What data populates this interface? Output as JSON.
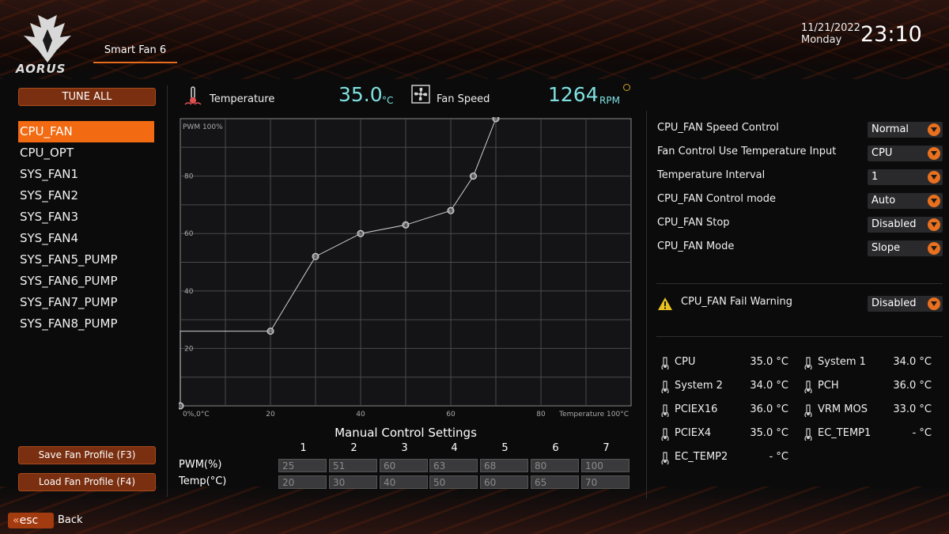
{
  "header": {
    "brand": "AORUS",
    "tab": "Smart Fan 6",
    "date": "11/21/2022",
    "day": "Monday",
    "time": "23:10"
  },
  "left_panel": {
    "tune_all": "TUNE ALL",
    "fans": [
      "CPU_FAN",
      "CPU_OPT",
      "SYS_FAN1",
      "SYS_FAN2",
      "SYS_FAN3",
      "SYS_FAN4",
      "SYS_FAN5_PUMP",
      "SYS_FAN6_PUMP",
      "SYS_FAN7_PUMP",
      "SYS_FAN8_PUMP"
    ],
    "selected_fan": "CPU_FAN",
    "save_profile": "Save Fan Profile (F3)",
    "load_profile": "Load Fan Profile (F4)"
  },
  "footer": {
    "esc": "esc",
    "back": "Back"
  },
  "readouts": {
    "temperature_label": "Temperature",
    "temperature_value": "35.0",
    "temperature_unit": "°C",
    "fan_speed_label": "Fan Speed",
    "fan_speed_value": "1264",
    "fan_speed_unit": "RPM"
  },
  "chart_data": {
    "type": "line",
    "ylabel": "PWM 100%",
    "xlabel": "Temperature 100°C",
    "origin_label": "0%,0°C",
    "xlim": [
      0,
      100
    ],
    "ylim": [
      0,
      100
    ],
    "x_ticks": [
      "20",
      "40",
      "60",
      "80"
    ],
    "y_ticks": [
      "20",
      "40",
      "60",
      "80"
    ],
    "series": [
      {
        "points": [
          {
            "label": "0",
            "x": 0,
            "y": 0
          },
          {
            "label": "",
            "x": 0,
            "y": 26
          },
          {
            "label": "1",
            "x": 20,
            "y": 26
          },
          {
            "label": "2",
            "x": 30,
            "y": 52
          },
          {
            "label": "3",
            "x": 40,
            "y": 60
          },
          {
            "label": "4",
            "x": 50,
            "y": 63
          },
          {
            "label": "5",
            "x": 60,
            "y": 68
          },
          {
            "label": "6",
            "x": 65,
            "y": 80
          },
          {
            "label": "7",
            "x": 70,
            "y": 100
          }
        ]
      }
    ]
  },
  "manual": {
    "title": "Manual Control Settings",
    "columns": [
      "1",
      "2",
      "3",
      "4",
      "5",
      "6",
      "7"
    ],
    "pwm_label": "PWM(%)",
    "temp_label": "Temp(°C)",
    "pwm": [
      "25",
      "51",
      "60",
      "63",
      "68",
      "80",
      "100"
    ],
    "temp": [
      "20",
      "30",
      "40",
      "50",
      "60",
      "65",
      "70"
    ]
  },
  "settings": [
    {
      "label": "CPU_FAN Speed Control",
      "value": "Normal"
    },
    {
      "label": "Fan Control Use Temperature Input",
      "value": "CPU"
    },
    {
      "label": "Temperature Interval",
      "value": "1"
    },
    {
      "label": "CPU_FAN Control mode",
      "value": "Auto"
    },
    {
      "label": "CPU_FAN Stop",
      "value": "Disabled"
    },
    {
      "label": "CPU_FAN Mode",
      "value": "Slope"
    }
  ],
  "fail_warning": {
    "label": "CPU_FAN Fail Warning",
    "value": "Disabled"
  },
  "sensors": [
    {
      "name": "CPU",
      "value": "35.0 °C"
    },
    {
      "name": "System 1",
      "value": "34.0 °C"
    },
    {
      "name": "System 2",
      "value": "34.0 °C"
    },
    {
      "name": "PCH",
      "value": "36.0 °C"
    },
    {
      "name": "PCIEX16",
      "value": "36.0 °C"
    },
    {
      "name": "VRM MOS",
      "value": "33.0 °C"
    },
    {
      "name": "PCIEX4",
      "value": "35.0 °C"
    },
    {
      "name": "EC_TEMP1",
      "value": "- °C"
    },
    {
      "name": "EC_TEMP2",
      "value": "- °C"
    }
  ],
  "colors": {
    "accent": "#f26a12",
    "readout": "#7fe0e0",
    "button": "#7a2f10"
  }
}
